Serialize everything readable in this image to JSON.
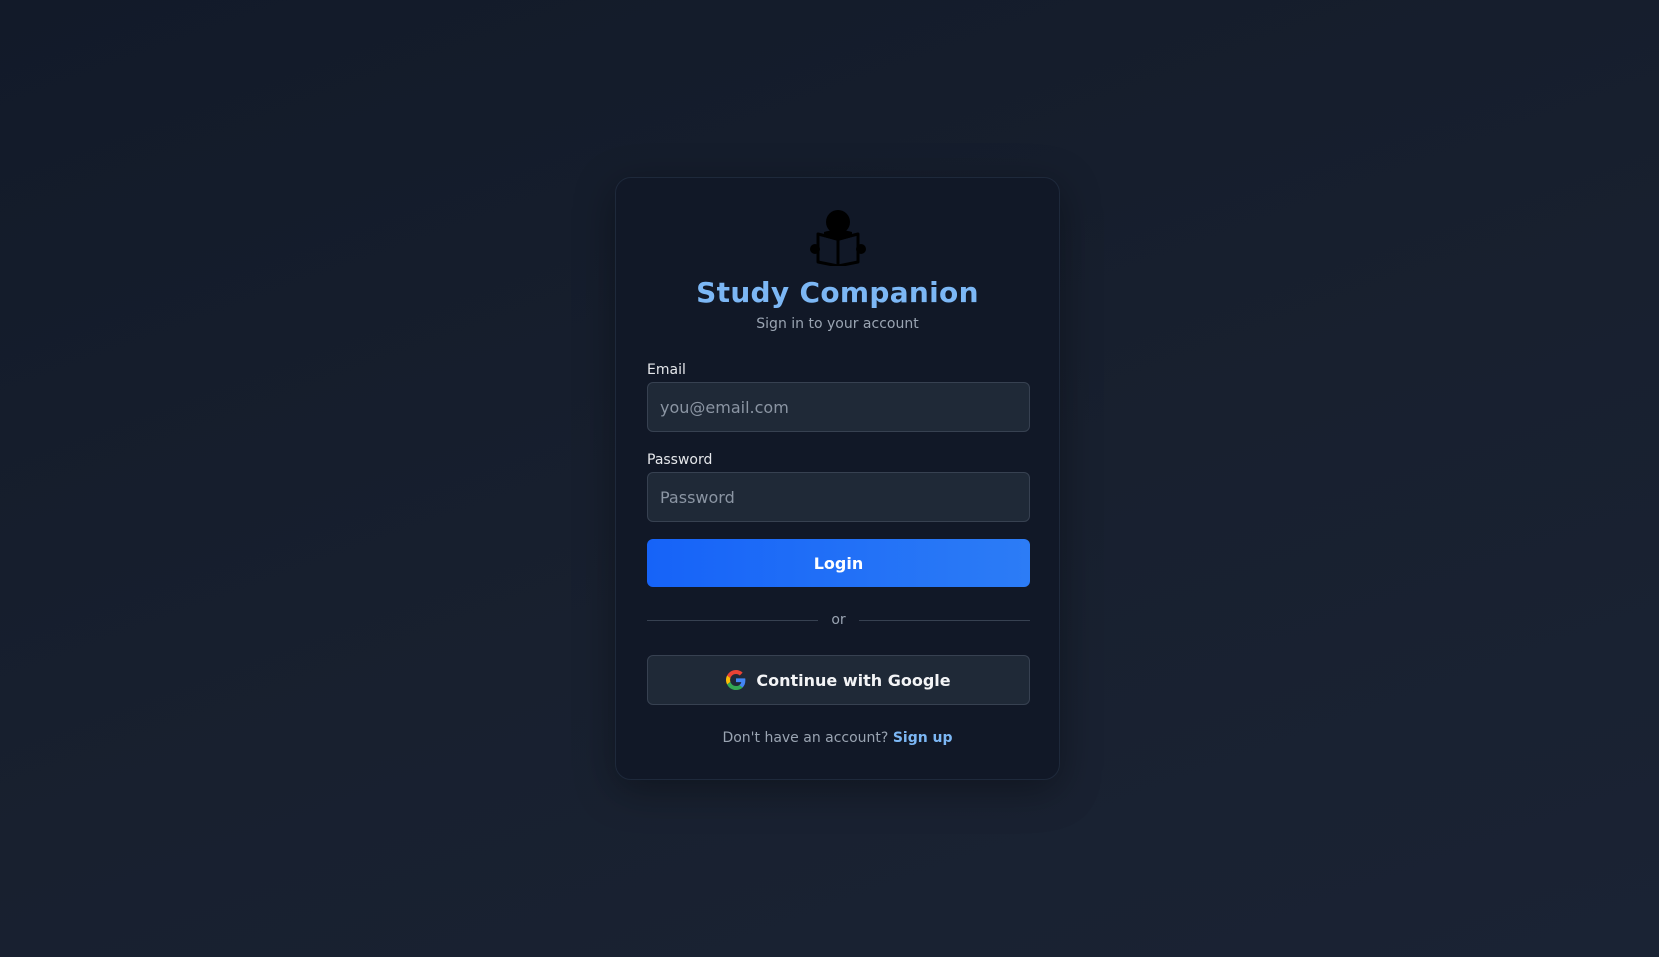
{
  "app": {
    "title": "Study Companion",
    "subtitle": "Sign in to your account",
    "logo_icon": "reading-person-icon"
  },
  "form": {
    "email_label": "Email",
    "email_placeholder": "you@email.com",
    "email_value": "",
    "password_label": "Password",
    "password_placeholder": "Password",
    "password_value": "",
    "login_label": "Login",
    "divider_text": "or",
    "google_label": "Continue with Google",
    "google_icon": "google-icon"
  },
  "footer": {
    "prompt": "Don't have an account?",
    "signup_label": "Sign up"
  },
  "colors": {
    "accent": "#7cb7f5",
    "primary_button": "#1663f8",
    "card_background": "#111827",
    "page_background": "#151d2c"
  }
}
